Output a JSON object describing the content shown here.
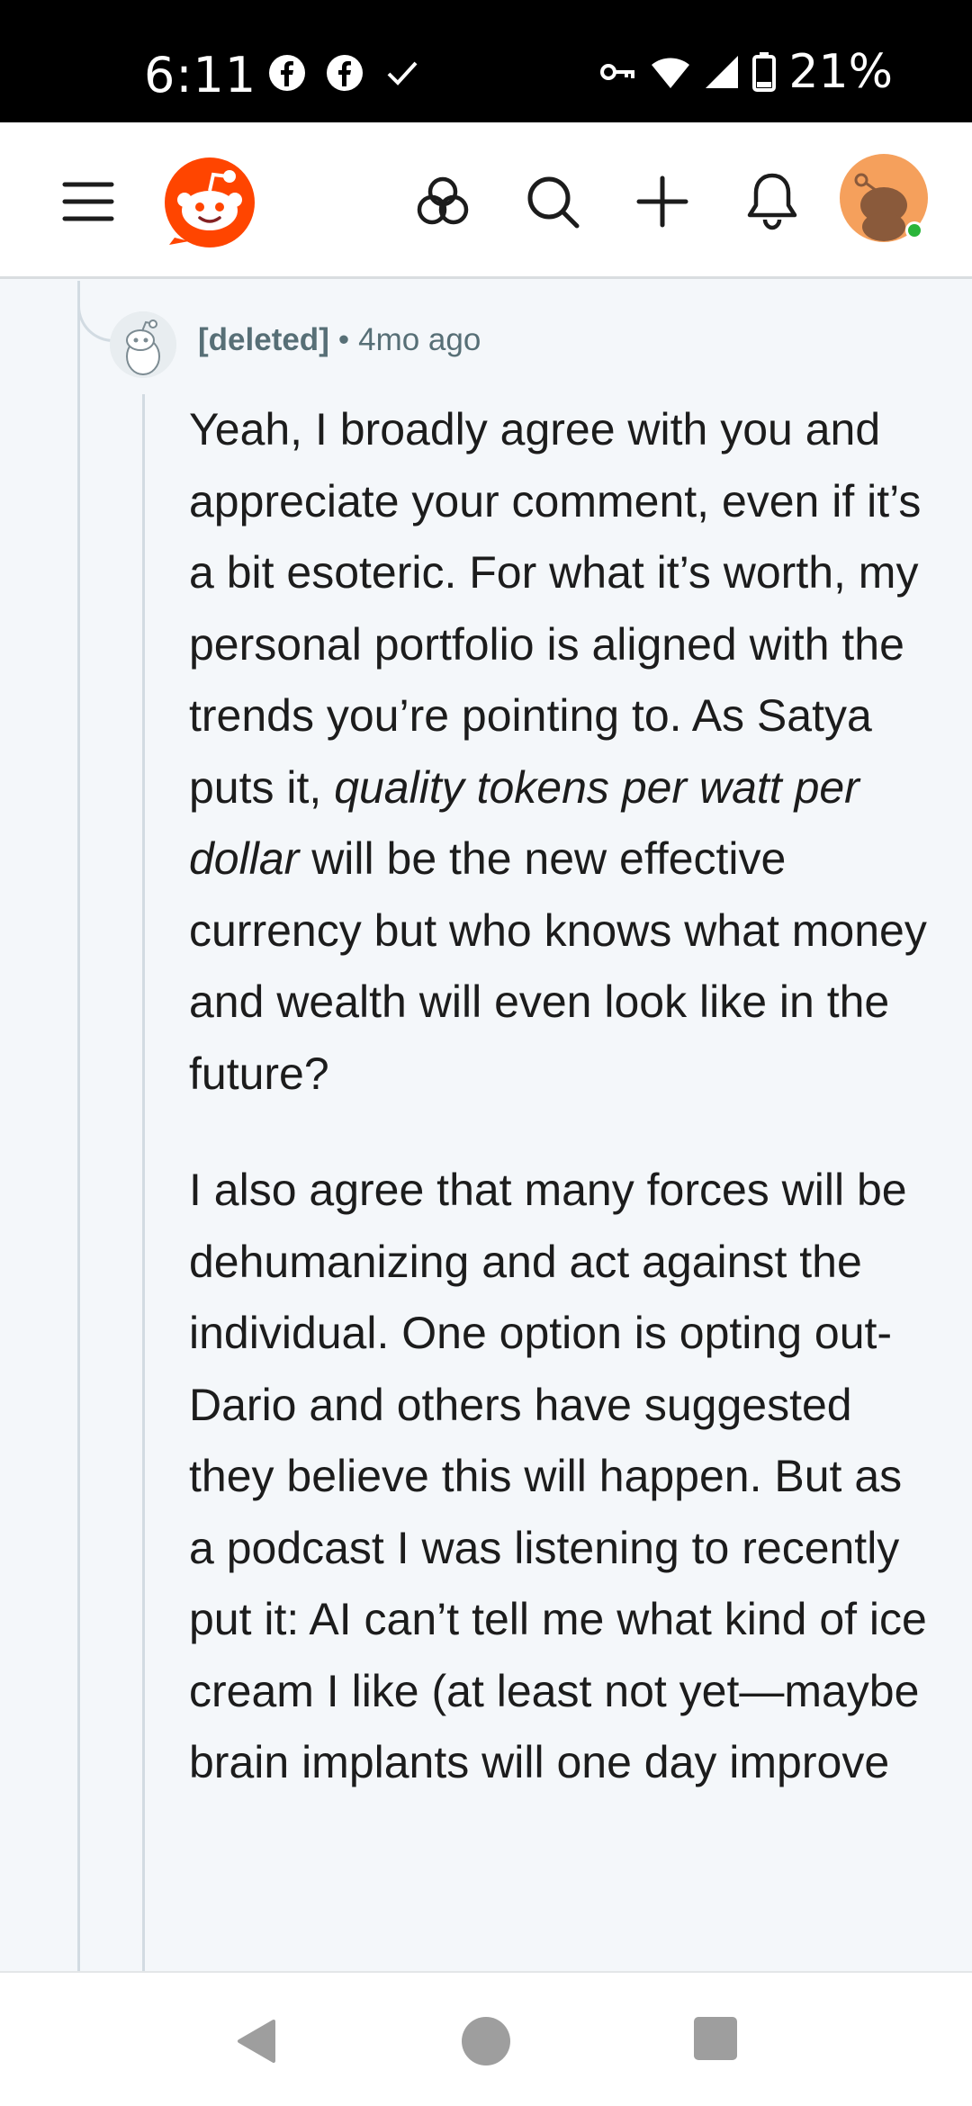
{
  "status_bar": {
    "time": "6:11",
    "battery": "21%",
    "icons_left": [
      "facebook-icon",
      "facebook-icon",
      "check-icon"
    ],
    "icons_right": [
      "vpn-key-icon",
      "wifi-icon",
      "signal-icon",
      "battery-icon"
    ]
  },
  "header": {
    "icons": [
      "menu-icon",
      "reddit-logo",
      "popular-icon",
      "search-icon",
      "create-post-icon",
      "notifications-icon",
      "user-avatar"
    ],
    "online_status_color": "#2ab53a"
  },
  "comment": {
    "author": "[deleted]",
    "separator": "•",
    "time": "4mo ago",
    "paragraphs": [
      {
        "before": "Yeah, I broadly agree with you and appreciate your comment, even if it’s a bit esoteric. For what it’s worth, my personal portfolio is aligned with the trends you’re pointing to. As Satya puts it, ",
        "emphasis": "quality tokens per watt per dollar",
        "after": " will be the new effective currency but who knows what money and wealth will even look like in the future?"
      },
      {
        "text": "I also agree that many forces will be dehumanizing and act against the individual. One option is opting out- Dario and others have suggested they believe this will happen. But as a podcast I was listening to recently put it: AI can’t tell me what kind of ice cream I like (at least not yet—maybe brain implants will one day improve"
      }
    ]
  },
  "nav": {
    "buttons": [
      "back-button",
      "home-button",
      "recents-button"
    ]
  },
  "colors": {
    "brand": "#ff4500",
    "meta_text": "#576f76",
    "thread_line": "#d2dbe2",
    "background": "#f4f7fa"
  }
}
